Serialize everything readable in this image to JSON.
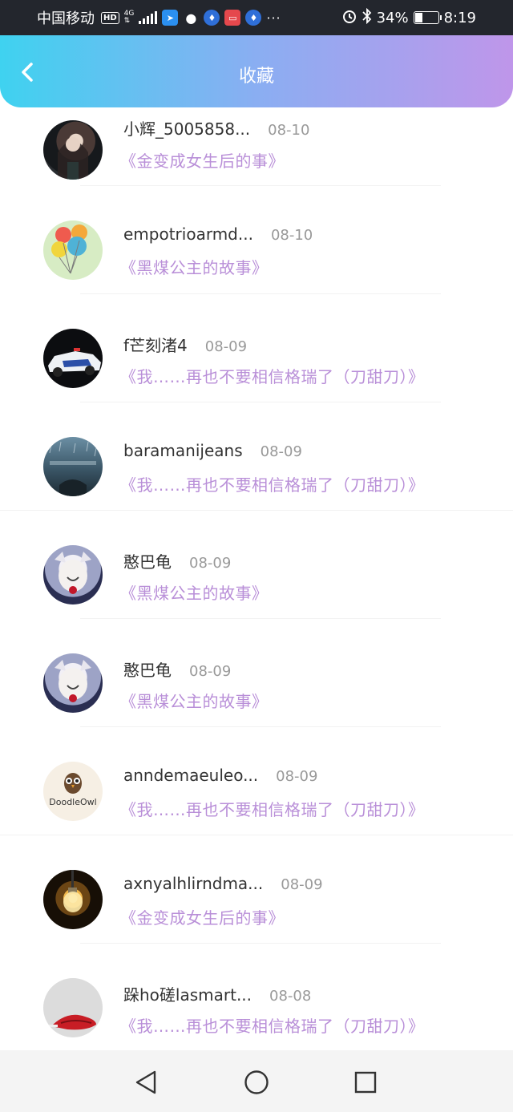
{
  "status_bar": {
    "carrier": "中国移动",
    "hd": "HD",
    "network": "4G",
    "battery_percent": "34%",
    "battery_level": 0.34,
    "time": "8:19"
  },
  "header": {
    "title": "收藏"
  },
  "favorites": [
    {
      "user": "小辉_5005858...",
      "date": "08-10",
      "story": "《金变成女生后的事》",
      "avatar": "girl-dark-avatar"
    },
    {
      "user": "empotrioarmd...",
      "date": "08-10",
      "story": "《黑煤公主的故事》",
      "avatar": "balloons-avatar"
    },
    {
      "user": "f芒刻渚4",
      "date": "08-09",
      "story": "《我……再也不要相信格瑞了（刀甜刀）》",
      "avatar": "police-car-avatar"
    },
    {
      "user": "baramanijeans",
      "date": "08-09",
      "story": "《我……再也不要相信格瑞了（刀甜刀）》",
      "avatar": "rain-scene-avatar"
    },
    {
      "user": "憨巴龟",
      "date": "08-09",
      "story": "《黑煤公主的故事》",
      "avatar": "anime-fox-avatar"
    },
    {
      "user": "憨巴龟",
      "date": "08-09",
      "story": "《黑煤公主的故事》",
      "avatar": "anime-fox-avatar"
    },
    {
      "user": "anndemaeuleo...",
      "date": "08-09",
      "story": "《我……再也不要相信格瑞了（刀甜刀）》",
      "avatar": "doodle-owl-avatar",
      "avatar_text": "DoodleOwl"
    },
    {
      "user": "axnyalhlirndma...",
      "date": "08-09",
      "story": "《金变成女生后的事》",
      "avatar": "lightbulb-avatar"
    },
    {
      "user": "跺ho磋lasmart...",
      "date": "08-08",
      "story": "《我……再也不要相信格瑞了（刀甜刀）》",
      "avatar": "red-lips-avatar"
    }
  ],
  "colors": {
    "header_start": "#3fd2f0",
    "header_end": "#bf96ea",
    "story_text": "#b98fd8",
    "username_text": "#333333",
    "date_text": "#999999"
  }
}
